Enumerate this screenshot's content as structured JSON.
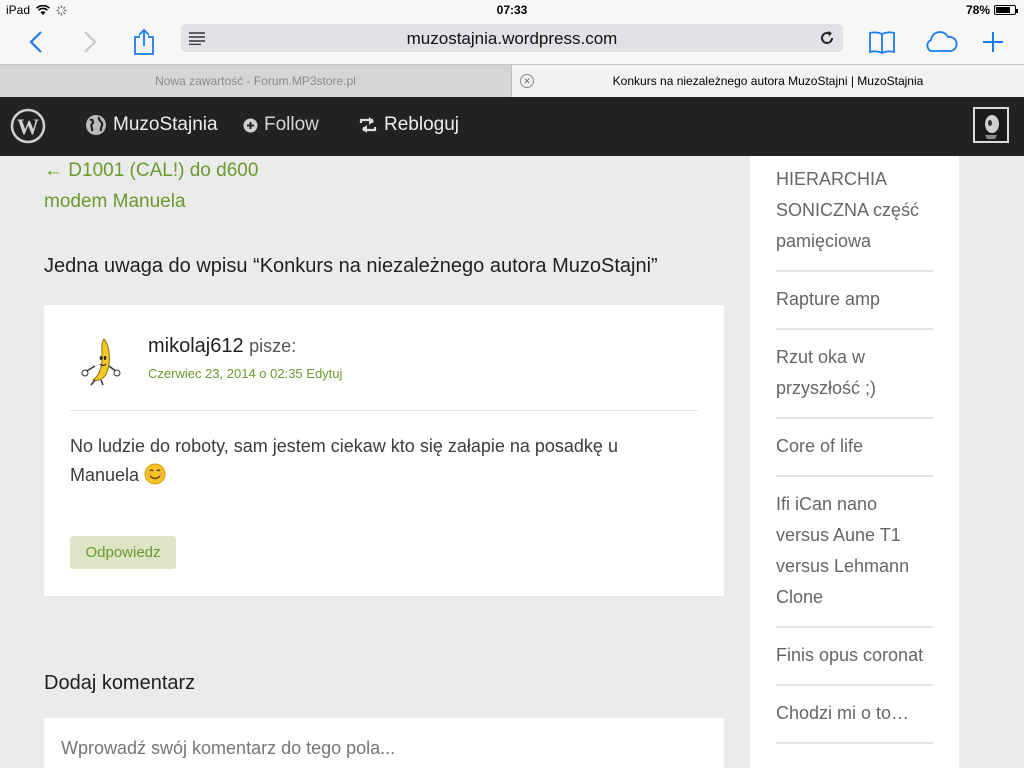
{
  "status_bar": {
    "device": "iPad",
    "time": "07:33",
    "battery": "78%",
    "battery_level": 0.78
  },
  "toolbar": {
    "url": "muzostajnia.wordpress.com"
  },
  "tabs": [
    {
      "label": "Nowa zawartość - Forum.MP3store.pl",
      "active": false
    },
    {
      "label": "Konkurs na niezależnego autora MuzoStajni | MuzoStajnia",
      "active": true
    }
  ],
  "wpbar": {
    "site_label": "MuzoStajnia",
    "follow_label": "Follow",
    "reblog_label": "Rebloguj"
  },
  "post_nav": {
    "prev_arrow": "←",
    "prev_line1": "D1001 (CAL!) do d600",
    "prev_line2": "modem Manuela"
  },
  "comments": {
    "title": "Jedna uwaga do wpisu “Konkurs na niezależnego autora MuzoStajni”",
    "items": [
      {
        "author": "mikolaj612",
        "says": "pisze:",
        "date": "Czerwiec 23, 2014 o 02:35",
        "edit": "Edytuj",
        "text": "No ludzie do roboty, sam jestem ciekaw kto się załapie na posadkę u Manuela",
        "reply_label": "Odpowiedz"
      }
    ]
  },
  "respond": {
    "title": "Dodaj komentarz",
    "placeholder": "Wprowadź swój komentarz do tego pola..."
  },
  "sidebar": {
    "items": [
      {
        "label": "HIERARCHIA SONICZNA część pamięciowa"
      },
      {
        "label": "Rapture amp"
      },
      {
        "label": "Rzut oka w przyszłość ;)"
      },
      {
        "label": "Core of life"
      },
      {
        "label": "Ifi iCan nano versus Aune T1 versus Lehmann Clone"
      },
      {
        "label": "Finis opus coronat"
      },
      {
        "label": "Chodzi mi o to…"
      }
    ]
  },
  "colors": {
    "accent_green": "#6a9a2c",
    "ios_blue": "#1a7cf5",
    "admin_bar": "#222222"
  },
  "icons": [
    "back-icon",
    "forward-icon",
    "share-icon",
    "reader-icon",
    "reload-icon",
    "bookmarks-icon",
    "icloud-tabs-icon",
    "new-tab-icon",
    "wordpress-logo-icon",
    "globe-icon",
    "plus-circle-icon",
    "reblog-icon",
    "smiley-icon"
  ]
}
